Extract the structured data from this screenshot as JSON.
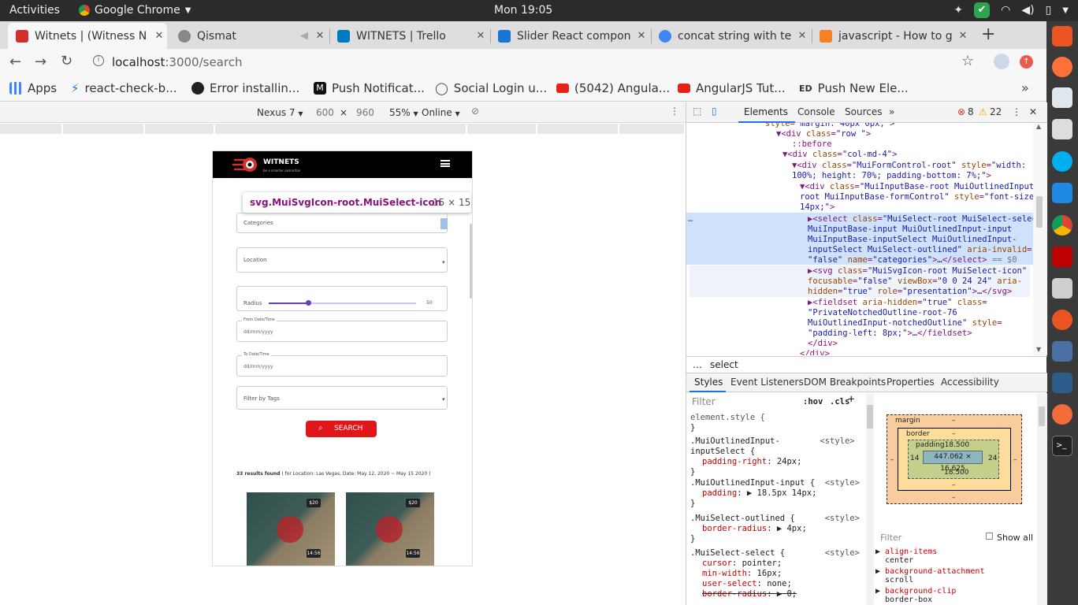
{
  "system": {
    "activities": "Activities",
    "app_name": "Google Chrome",
    "clock": "Mon 19:05"
  },
  "tabs": [
    {
      "title": "Witnets | (Witness N",
      "active": true,
      "color": "#d32f2f"
    },
    {
      "title": "Qismat",
      "active": false,
      "color": "#888888"
    },
    {
      "title": "WITNETS | Trello",
      "active": false,
      "color": "#0079bf"
    },
    {
      "title": "Slider React compon",
      "active": false,
      "color": "#1976d2"
    },
    {
      "title": "concat string with te",
      "active": false,
      "color": "#4285f4"
    },
    {
      "title": "javascript - How to g",
      "active": false,
      "color": "#f48024"
    }
  ],
  "toolbar": {
    "url_host": "localhost",
    "url_path": ":3000/search"
  },
  "bookmarks": [
    {
      "label": "Apps",
      "color": "#4285f4"
    },
    {
      "label": "react-check-b...",
      "color": "#1976d2"
    },
    {
      "label": "Error installin...",
      "color": "#222222"
    },
    {
      "label": "Push Notificat...",
      "color": "#111111"
    },
    {
      "label": "Social Login u...",
      "color": "#444444"
    },
    {
      "label": "(5042) Angula...",
      "color": "#e62117"
    },
    {
      "label": "AngularJS Tut...",
      "color": "#e62117"
    },
    {
      "label": "Push New Ele...",
      "color": "#333333"
    }
  ],
  "devbar": {
    "device": "Nexus 7",
    "width": "600",
    "times": "×",
    "height": "960",
    "zoom": "55%",
    "network": "Online"
  },
  "site": {
    "brand": "WITNETS",
    "tagline": "be a smarter samaritan",
    "tooltip_selector": "svg.MuiSvgIcon-root.MuiSelect-icon",
    "tooltip_size": "15 × 15",
    "fields": {
      "categories": "Categories",
      "location": "Location",
      "radius": "Radius",
      "radius_value": "50",
      "radius_level": 0.27,
      "from_label": "From Date/Time",
      "from_placeholder": "dd/mm/yyyy",
      "to_label": "To Date/Time",
      "to_placeholder": "dd/mm/yyyy",
      "tags": "Filter by Tags"
    },
    "search_button": "SEARCH",
    "results_count": "33 results found",
    "results_meta": "( for Location: Las Vegas, Date: May 12, 2020 ~ May 15 2020 )",
    "cards": [
      {
        "price": "$20",
        "duration": "14:56"
      },
      {
        "price": "$20",
        "duration": "14:56"
      }
    ]
  },
  "devtools": {
    "tabs": [
      "Elements",
      "Console",
      "Sources"
    ],
    "errors": "8",
    "warnings": "22",
    "breadcrumb": "select",
    "subtabs": [
      "Styles",
      "Event Listeners",
      "DOM Breakpoints",
      "Properties",
      "Accessibility"
    ],
    "filter_placeholder": "Filter",
    "hov": ":hov",
    "cls": ".cls",
    "show_all": "Show all",
    "box": {
      "margin": "margin",
      "border": "border",
      "padding": "padding18.500",
      "content": "447.062 × 16.625",
      "left": "14",
      "right": "24",
      "bottom": "18.500",
      "dash": "–"
    },
    "computed": [
      {
        "prop": "align-items",
        "value": "center"
      },
      {
        "prop": "background-attachment",
        "value": "scroll"
      },
      {
        "prop": "background-clip",
        "value": "border-box"
      }
    ]
  }
}
